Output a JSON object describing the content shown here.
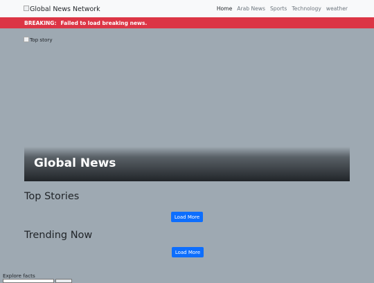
{
  "navbar": {
    "brand": "Global News Network",
    "links": [
      {
        "label": "Home",
        "active": true
      },
      {
        "label": "Arab News",
        "active": false
      },
      {
        "label": "Sports",
        "active": false
      },
      {
        "label": "Technology",
        "active": false
      },
      {
        "label": "weather",
        "active": false
      }
    ]
  },
  "breaking": {
    "label": "BREAKING:",
    "message": "Failed to load breaking news."
  },
  "hero": {
    "image_alt": "Top story",
    "title": "Global News"
  },
  "sections": [
    {
      "title": "Top Stories",
      "button_label": "Load More"
    },
    {
      "title": "Trending Now",
      "button_label": "Load More"
    }
  ],
  "footer": {
    "explore_label": "Explore facts"
  },
  "colors": {
    "page_bg": "#9ea9b2",
    "navbar_bg": "#f8f9fa",
    "breaking_bg": "#dc3545",
    "button_bg": "#0d6efd"
  }
}
